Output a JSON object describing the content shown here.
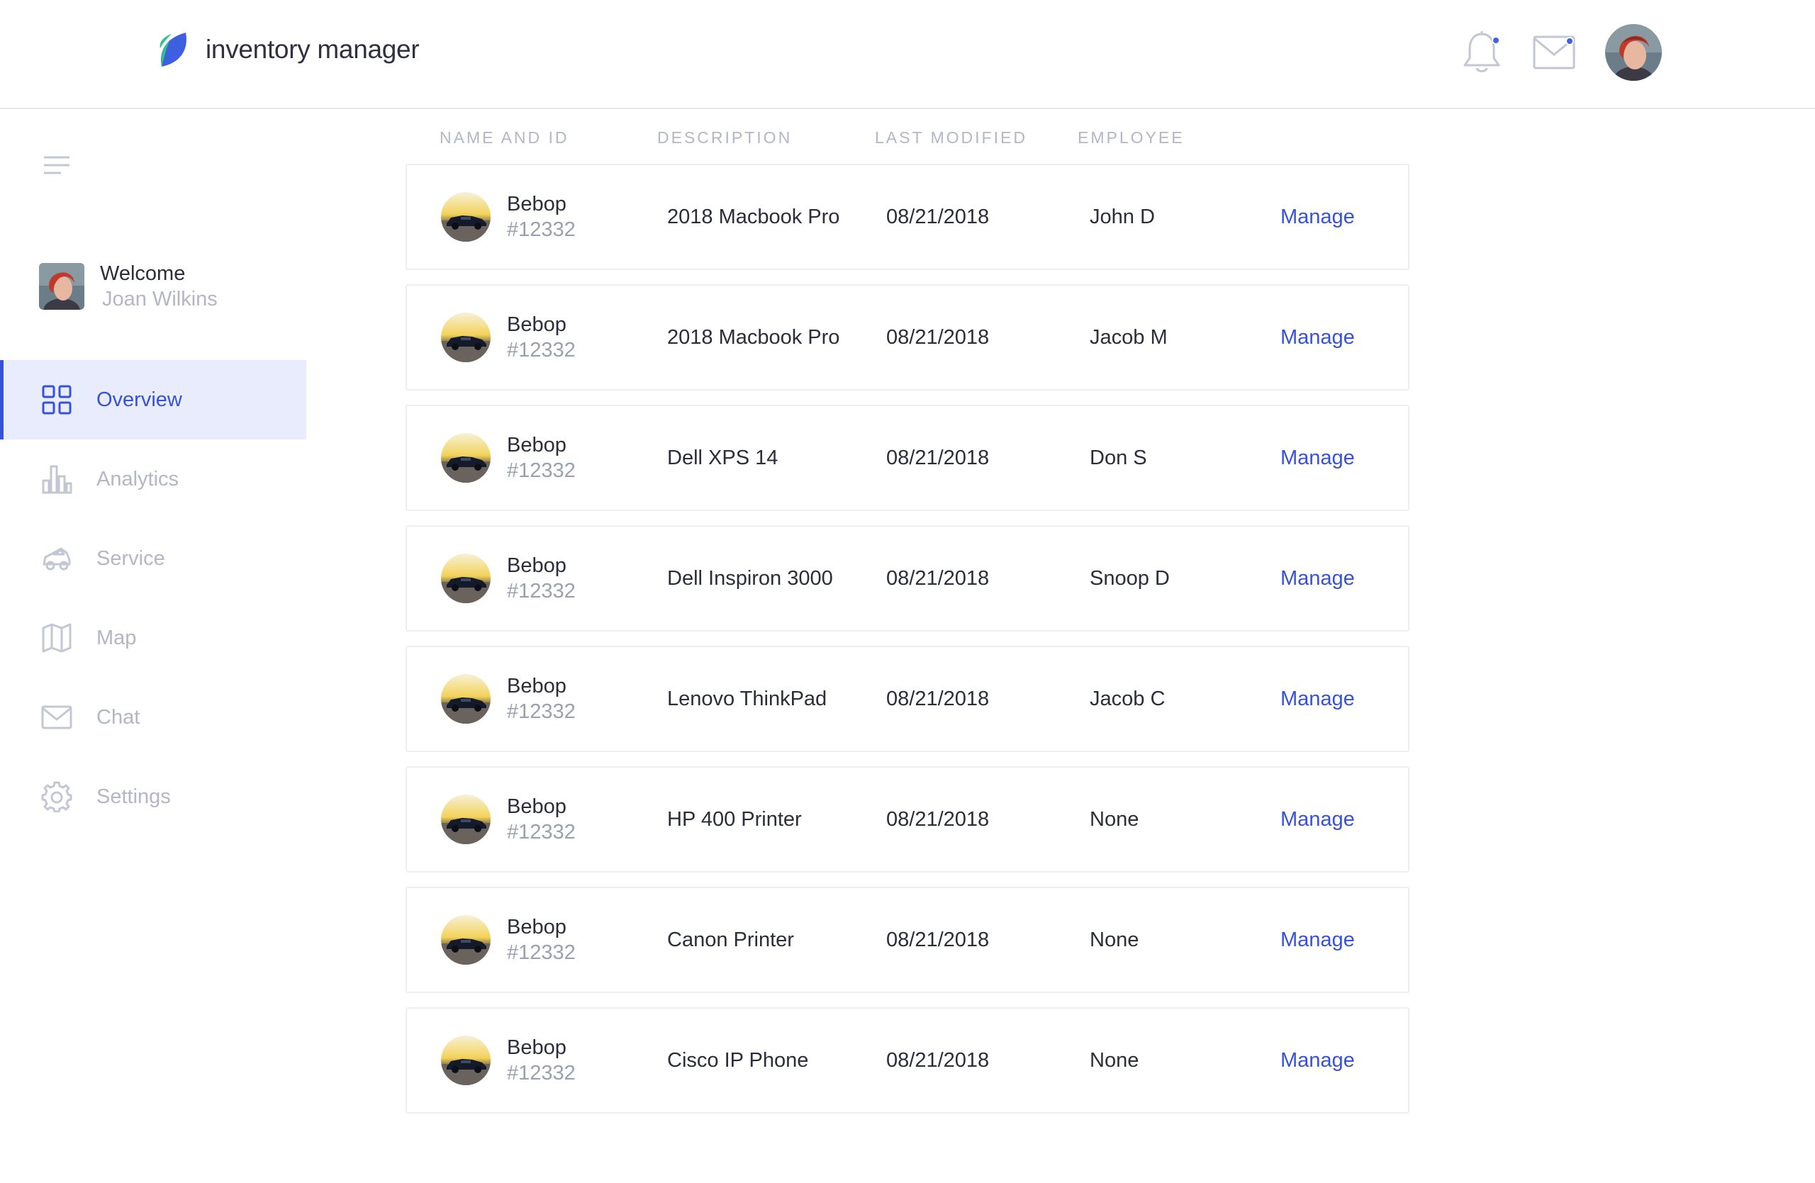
{
  "app": {
    "name": "inventory manager",
    "brand_colors": {
      "leaf_green": "#2ec48b",
      "leaf_blue": "#3d5fe0",
      "accent": "#3552d8"
    }
  },
  "header": {
    "notifications": {
      "icon": "bell-icon",
      "has_unread": true
    },
    "messages": {
      "icon": "mail-icon",
      "has_unread": true
    },
    "avatar": {
      "icon": "user-avatar"
    }
  },
  "sidebar": {
    "menu_icon": "hamburger-icon",
    "welcome": {
      "greeting": "Welcome",
      "user_name": "Joan Wilkins"
    },
    "items": [
      {
        "label": "Overview",
        "icon": "grid-icon",
        "active": true
      },
      {
        "label": "Analytics",
        "icon": "bar-chart-icon",
        "active": false
      },
      {
        "label": "Service",
        "icon": "car-icon",
        "active": false
      },
      {
        "label": "Map",
        "icon": "map-icon",
        "active": false
      },
      {
        "label": "Chat",
        "icon": "envelope-icon",
        "active": false
      },
      {
        "label": "Settings",
        "icon": "gear-icon",
        "active": false
      }
    ]
  },
  "table": {
    "columns": [
      "NAME AND ID",
      "DESCRIPTION",
      "LAST MODIFIED",
      "EMPLOYEE"
    ],
    "rows": [
      {
        "name": "Bebop",
        "id": "#12332",
        "description": "2018 Macbook Pro",
        "last_modified": "08/21/2018",
        "employee": "John D",
        "action": "Manage"
      },
      {
        "name": "Bebop",
        "id": "#12332",
        "description": "2018 Macbook Pro",
        "last_modified": "08/21/2018",
        "employee": "Jacob M",
        "action": "Manage"
      },
      {
        "name": "Bebop",
        "id": "#12332",
        "description": "Dell XPS 14",
        "last_modified": "08/21/2018",
        "employee": "Don S",
        "action": "Manage"
      },
      {
        "name": "Bebop",
        "id": "#12332",
        "description": "Dell Inspiron 3000",
        "last_modified": "08/21/2018",
        "employee": "Snoop D",
        "action": "Manage"
      },
      {
        "name": "Bebop",
        "id": "#12332",
        "description": "Lenovo ThinkPad",
        "last_modified": "08/21/2018",
        "employee": "Jacob C",
        "action": "Manage"
      },
      {
        "name": "Bebop",
        "id": "#12332",
        "description": "HP 400 Printer",
        "last_modified": "08/21/2018",
        "employee": "None",
        "action": "Manage"
      },
      {
        "name": "Bebop",
        "id": "#12332",
        "description": "Canon Printer",
        "last_modified": "08/21/2018",
        "employee": "None",
        "action": "Manage"
      },
      {
        "name": "Bebop",
        "id": "#12332",
        "description": "Cisco IP Phone",
        "last_modified": "08/21/2018",
        "employee": "None",
        "action": "Manage"
      }
    ]
  }
}
